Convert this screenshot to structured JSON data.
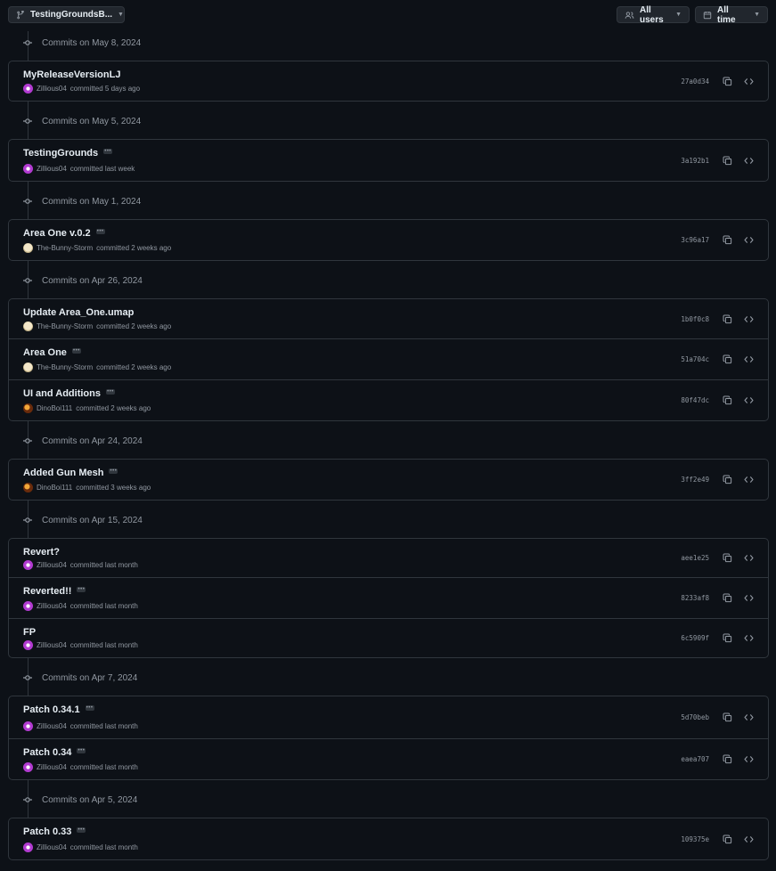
{
  "toolbar": {
    "branch_label": "TestingGroundsB...",
    "users_label": "All users",
    "time_label": "All time"
  },
  "groups": [
    {
      "date_label": "Commits on May 8, 2024",
      "commits": [
        {
          "title": "MyReleaseVersionLJ",
          "author": "Zillious04",
          "time": "committed 5 days ago",
          "sha": "27a0d34",
          "has_more": false,
          "avatar": "zillious"
        }
      ]
    },
    {
      "date_label": "Commits on May 5, 2024",
      "commits": [
        {
          "title": "TestingGrounds",
          "author": "Zillious04",
          "time": "committed last week",
          "sha": "3a192b1",
          "has_more": true,
          "avatar": "zillious"
        }
      ]
    },
    {
      "date_label": "Commits on May 1, 2024",
      "commits": [
        {
          "title": "Area One v.0.2",
          "author": "The-Bunny-Storm",
          "time": "committed 2 weeks ago",
          "sha": "3c96a17",
          "has_more": true,
          "avatar": "bunny"
        }
      ]
    },
    {
      "date_label": "Commits on Apr 26, 2024",
      "commits": [
        {
          "title": "Update Area_One.umap",
          "author": "The-Bunny-Storm",
          "time": "committed 2 weeks ago",
          "sha": "1b0f0c8",
          "has_more": false,
          "avatar": "bunny"
        },
        {
          "title": "Area One",
          "author": "The-Bunny-Storm",
          "time": "committed 2 weeks ago",
          "sha": "51a704c",
          "has_more": true,
          "avatar": "bunny"
        },
        {
          "title": "UI and Additions",
          "author": "DinoBoi111",
          "time": "committed 2 weeks ago",
          "sha": "80f47dc",
          "has_more": true,
          "avatar": "dino"
        }
      ]
    },
    {
      "date_label": "Commits on Apr 24, 2024",
      "commits": [
        {
          "title": "Added Gun Mesh",
          "author": "DinoBoi111",
          "time": "committed 3 weeks ago",
          "sha": "3ff2e49",
          "has_more": true,
          "avatar": "dino"
        }
      ]
    },
    {
      "date_label": "Commits on Apr 15, 2024",
      "commits": [
        {
          "title": "Revert?",
          "author": "Zillious04",
          "time": "committed last month",
          "sha": "aee1e25",
          "has_more": false,
          "avatar": "zillious"
        },
        {
          "title": "Reverted!!",
          "author": "Zillious04",
          "time": "committed last month",
          "sha": "8233af8",
          "has_more": true,
          "avatar": "zillious"
        },
        {
          "title": "FP",
          "author": "Zillious04",
          "time": "committed last month",
          "sha": "6c5909f",
          "has_more": false,
          "avatar": "zillious"
        }
      ]
    },
    {
      "date_label": "Commits on Apr 7, 2024",
      "commits": [
        {
          "title": "Patch 0.34.1",
          "author": "Zillious04",
          "time": "committed last month",
          "sha": "5d70beb",
          "has_more": true,
          "avatar": "zillious"
        },
        {
          "title": "Patch 0.34",
          "author": "Zillious04",
          "time": "committed last month",
          "sha": "eaea707",
          "has_more": true,
          "avatar": "zillious"
        }
      ]
    },
    {
      "date_label": "Commits on Apr 5, 2024",
      "commits": [
        {
          "title": "Patch 0.33",
          "author": "Zillious04",
          "time": "committed last month",
          "sha": "109375e",
          "has_more": true,
          "avatar": "zillious"
        }
      ]
    }
  ]
}
